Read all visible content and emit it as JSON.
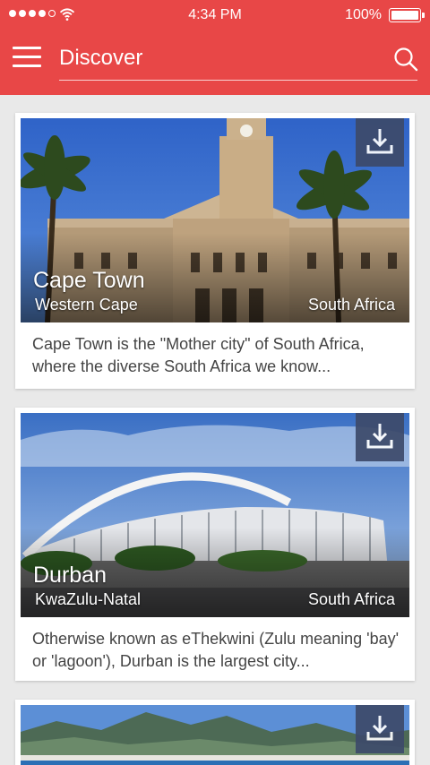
{
  "status_bar": {
    "time": "4:34 PM",
    "battery": "100%"
  },
  "header": {
    "title": "Discover",
    "menu_icon": "hamburger-menu-icon",
    "search_icon": "search-icon"
  },
  "colors": {
    "header": "#e84747",
    "download_button": "#3d4a6a",
    "background": "#e9e9e9"
  },
  "cards": [
    {
      "city": "Cape Town",
      "region": "Western Cape",
      "country": "South Africa",
      "description": "Cape Town is the \"Mother city\" of South Africa, where the diverse South Africa we know...",
      "icon": "download-icon"
    },
    {
      "city": "Durban",
      "region": "KwaZulu-Natal",
      "country": "South Africa",
      "description": "Otherwise known as eThekwini (Zulu meaning 'bay' or 'lagoon'), Durban is the largest city...",
      "icon": "download-icon"
    },
    {
      "city": "",
      "region": "",
      "country": "",
      "description": "",
      "icon": "download-icon"
    }
  ]
}
